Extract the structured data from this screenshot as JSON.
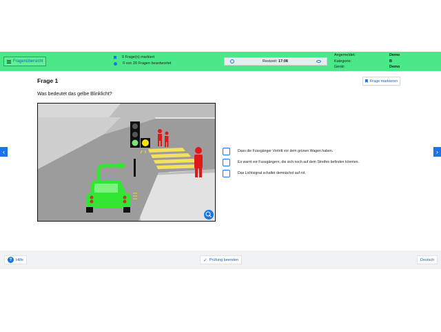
{
  "header": {
    "overview_label": "Fragenübersicht",
    "marked_status": "0 Frage(n) markiert",
    "answered_status": "0 von 20 Fragen beantwortet",
    "timer_label": "Restzeit:",
    "timer_value": "17:08",
    "meta": [
      {
        "label": "Angemeldet:",
        "value": "Demo"
      },
      {
        "label": "Kategorie:",
        "value": "B"
      },
      {
        "label": "Gerät:",
        "value": "Demo"
      }
    ]
  },
  "question": {
    "title": "Frage 1",
    "mark_label": "Frage markieren",
    "text": "Was bedeutet das gelbe Blinklicht?",
    "answers": [
      "Dass die Fussgänger Vortritt vor dem grünen Wagen haben.",
      "Es warnt vor Fussgängern, die sich noch auf dem Streifen befinden könnten.",
      "Das Lichtsignal schaltet demnächst auf rot."
    ]
  },
  "nav": {
    "prev": "‹",
    "next": "›"
  },
  "footer": {
    "help_label": "Hilfe",
    "finish_label": "Prüfung beenden",
    "language_label": "Deutsch"
  },
  "colors": {
    "header_bg": "#4be88a",
    "accent": "#1a73e8",
    "car": "#33e633",
    "pedestrian": "#e01818",
    "crosswalk": "#f5e25a"
  }
}
